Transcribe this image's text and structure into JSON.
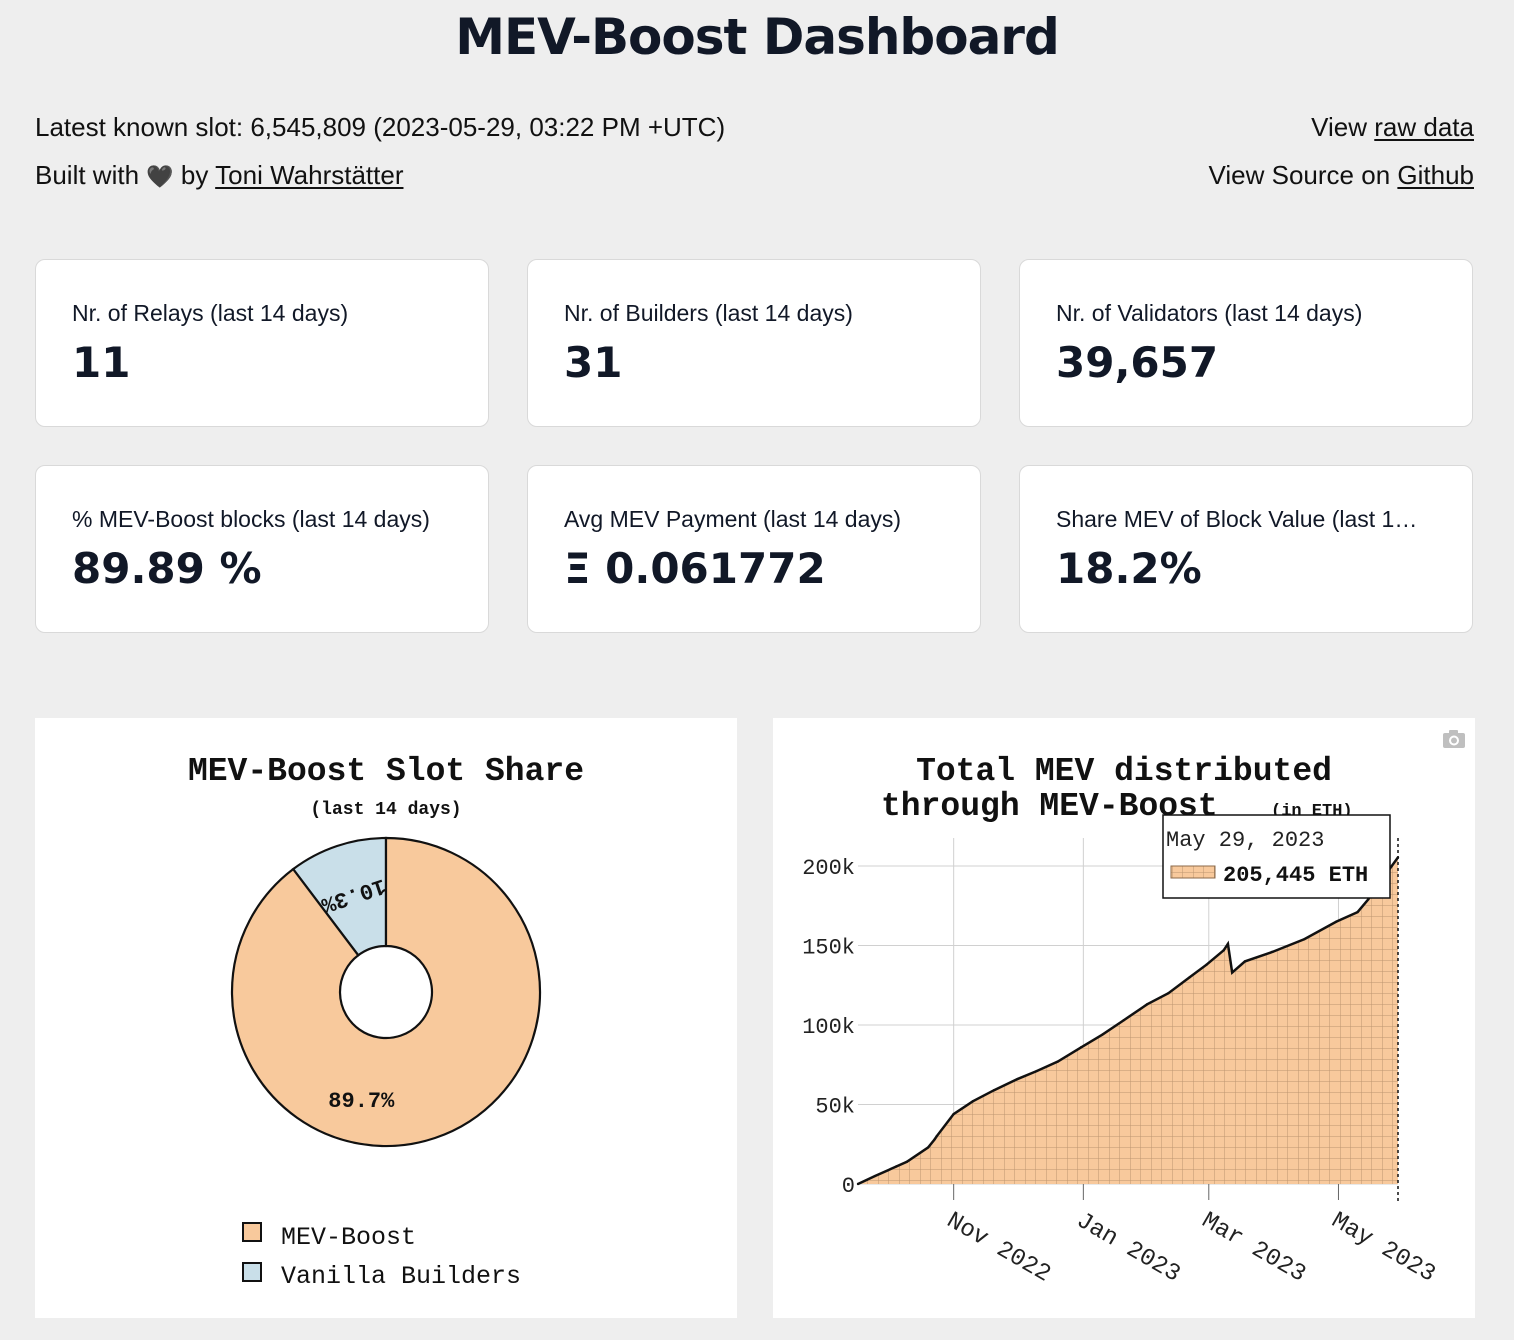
{
  "header": {
    "title": "MEV-Boost Dashboard"
  },
  "info": {
    "slot_text": "Latest known slot: 6,545,809 (2023-05-29, 03:22 PM +UTC)",
    "built_prefix": "Built with",
    "built_by": "by",
    "author": "Toni Wahrstätter",
    "view_prefix": "View",
    "raw_data_link": "raw data",
    "source_prefix": "View Source on",
    "github_link": "Github"
  },
  "cards": [
    {
      "label": "Nr. of Relays (last 14 days)",
      "value": "11"
    },
    {
      "label": "Nr. of Builders (last 14 days)",
      "value": "31"
    },
    {
      "label": "Nr. of Validators (last 14 days)",
      "value": "39,657"
    },
    {
      "label": "% MEV-Boost blocks (last 14 days)",
      "value": "89.89 %"
    },
    {
      "label": "Avg MEV Payment (last 14 days)",
      "value": "Ξ 0.061772"
    },
    {
      "label": "Share MEV of Block Value (last 1…",
      "value": "18.2%"
    }
  ],
  "pie": {
    "title": "MEV-Boost Slot Share",
    "subtitle": "(last 14 days)",
    "slices": [
      {
        "name": "MEV-Boost",
        "label": "89.7%",
        "color": "#f8c99c"
      },
      {
        "name": "Vanilla Builders",
        "label": "10.3%",
        "color": "#c9dfe9"
      }
    ]
  },
  "area": {
    "title_line1": "Total MEV distributed",
    "title_line2": "through MEV-Boost",
    "title_unit": "(in ETH)",
    "tooltip_date": "May 29, 2023",
    "tooltip_value": "205,445 ETH",
    "camera_icon": "camera-icon",
    "fill_color": "#f8c99c"
  },
  "chart_data": [
    {
      "type": "pie",
      "title": "MEV-Boost Slot Share",
      "subtitle": "(last 14 days)",
      "categories": [
        "MEV-Boost",
        "Vanilla Builders"
      ],
      "values": [
        89.7,
        10.3
      ],
      "hole": true,
      "legend": "bottom"
    },
    {
      "type": "area",
      "title": "Total MEV distributed through MEV-Boost (in ETH)",
      "xlabel": "",
      "ylabel": "",
      "x_ticks": [
        "Nov 2022",
        "Jan 2023",
        "Mar 2023",
        "May 2023"
      ],
      "y_ticks": [
        "0",
        "50k",
        "100k",
        "150k",
        "200k"
      ],
      "ylim": [
        0,
        215000
      ],
      "grid": true,
      "series": [
        {
          "x": [
            "2022-09-17",
            "2022-09-25",
            "2022-10-05",
            "2022-10-10",
            "2022-10-20",
            "2022-10-23",
            "2022-10-24",
            "2022-11-01",
            "2022-11-10",
            "2022-11-20",
            "2022-12-01",
            "2022-12-10",
            "2022-12-20",
            "2022-12-31",
            "2023-01-10",
            "2023-01-20",
            "2023-01-31",
            "2023-02-10",
            "2023-02-20",
            "2023-02-28",
            "2023-03-08",
            "2023-03-10",
            "2023-03-12",
            "2023-03-18",
            "2023-03-31",
            "2023-04-15",
            "2023-04-30",
            "2023-05-10",
            "2023-05-15",
            "2023-05-20",
            "2023-05-25",
            "2023-05-29"
          ],
          "y": [
            0,
            5000,
            11000,
            14000,
            23000,
            28000,
            30000,
            44000,
            52000,
            59000,
            66000,
            71000,
            77000,
            86000,
            94000,
            103000,
            113000,
            120000,
            130000,
            138000,
            147000,
            151000,
            133000,
            140000,
            146000,
            154000,
            165000,
            171000,
            179000,
            189000,
            198000,
            205445
          ]
        }
      ],
      "tooltip": {
        "date": "May 29, 2023",
        "value": "205,445 ETH"
      }
    }
  ]
}
